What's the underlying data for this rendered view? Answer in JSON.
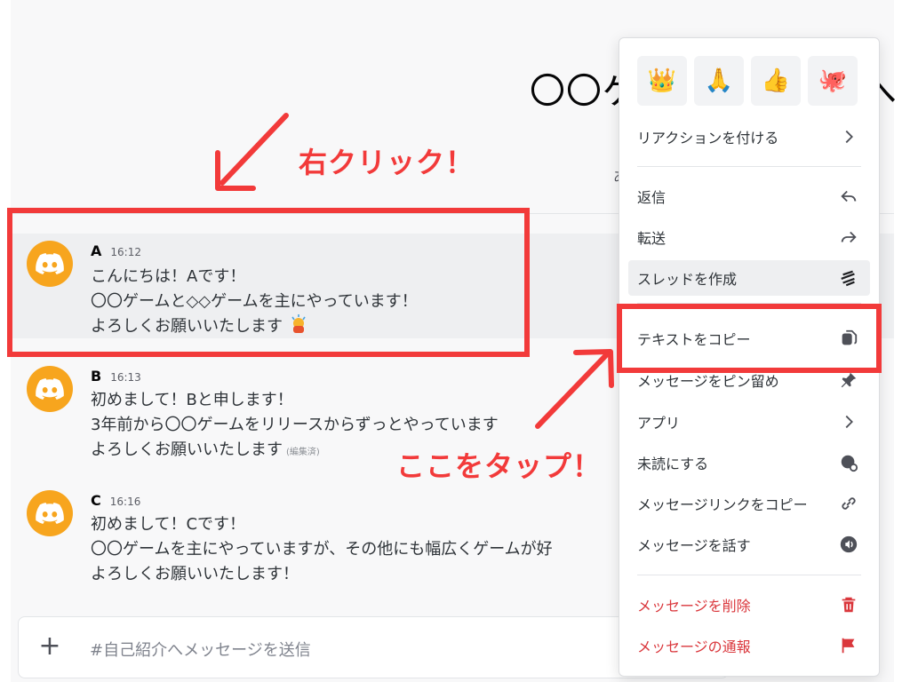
{
  "channel": {
    "title": "〇〇ゲ",
    "title_tail": "へ",
    "subtitle": "あ"
  },
  "messages": [
    {
      "author": "A",
      "time": "16:12",
      "lines": [
        "こんにちは！Aです！",
        "〇〇ゲームと◇◇ゲームを主にやっています！",
        "よろしくお願いいたします"
      ],
      "edited": ""
    },
    {
      "author": "B",
      "time": "16:13",
      "lines": [
        "初めまして！Bと申します！",
        "3年前から〇〇ゲームをリリースからずっとやっています",
        "よろしくお願いいたします"
      ],
      "edited": "(編集済)"
    },
    {
      "author": "C",
      "time": "16:16",
      "lines": [
        "初めまして！Cです！",
        "〇〇ゲームを主にやっていますが、その他にも幅広くゲームが好",
        "よろしくお願いいたします！"
      ],
      "edited": ""
    }
  ],
  "composer": {
    "placeholder": "#自己紹介へメッセージを送信",
    "plus_icon": "plus-icon"
  },
  "annotations": {
    "right_click": "右クリック！",
    "tap_here": "ここをタップ！",
    "color": "#f23a3a"
  },
  "context_menu": {
    "reactions": [
      "👑",
      "🙏",
      "👍",
      "🐙"
    ],
    "items": [
      {
        "label": "リアクションを付ける",
        "icon": "chevron-right-icon"
      },
      {
        "label": "返信",
        "icon": "reply-icon"
      },
      {
        "label": "転送",
        "icon": "forward-icon"
      },
      {
        "label": "スレッドを作成",
        "icon": "thread-icon"
      },
      {
        "label": "テキストをコピー",
        "icon": "copy-icon"
      },
      {
        "label": "メッセージをピン留め",
        "icon": "pin-icon"
      },
      {
        "label": "アプリ",
        "icon": "chevron-right-icon"
      },
      {
        "label": "未読にする",
        "icon": "mark-unread-icon"
      },
      {
        "label": "メッセージリンクをコピー",
        "icon": "link-icon"
      },
      {
        "label": "メッセージを話す",
        "icon": "speaker-icon"
      },
      {
        "label": "メッセージを削除",
        "icon": "trash-icon"
      },
      {
        "label": "メッセージの通報",
        "icon": "flag-icon"
      }
    ]
  },
  "colors": {
    "avatar": "#f7a51e",
    "danger": "#da373c",
    "annotation": "#f23a3a"
  }
}
